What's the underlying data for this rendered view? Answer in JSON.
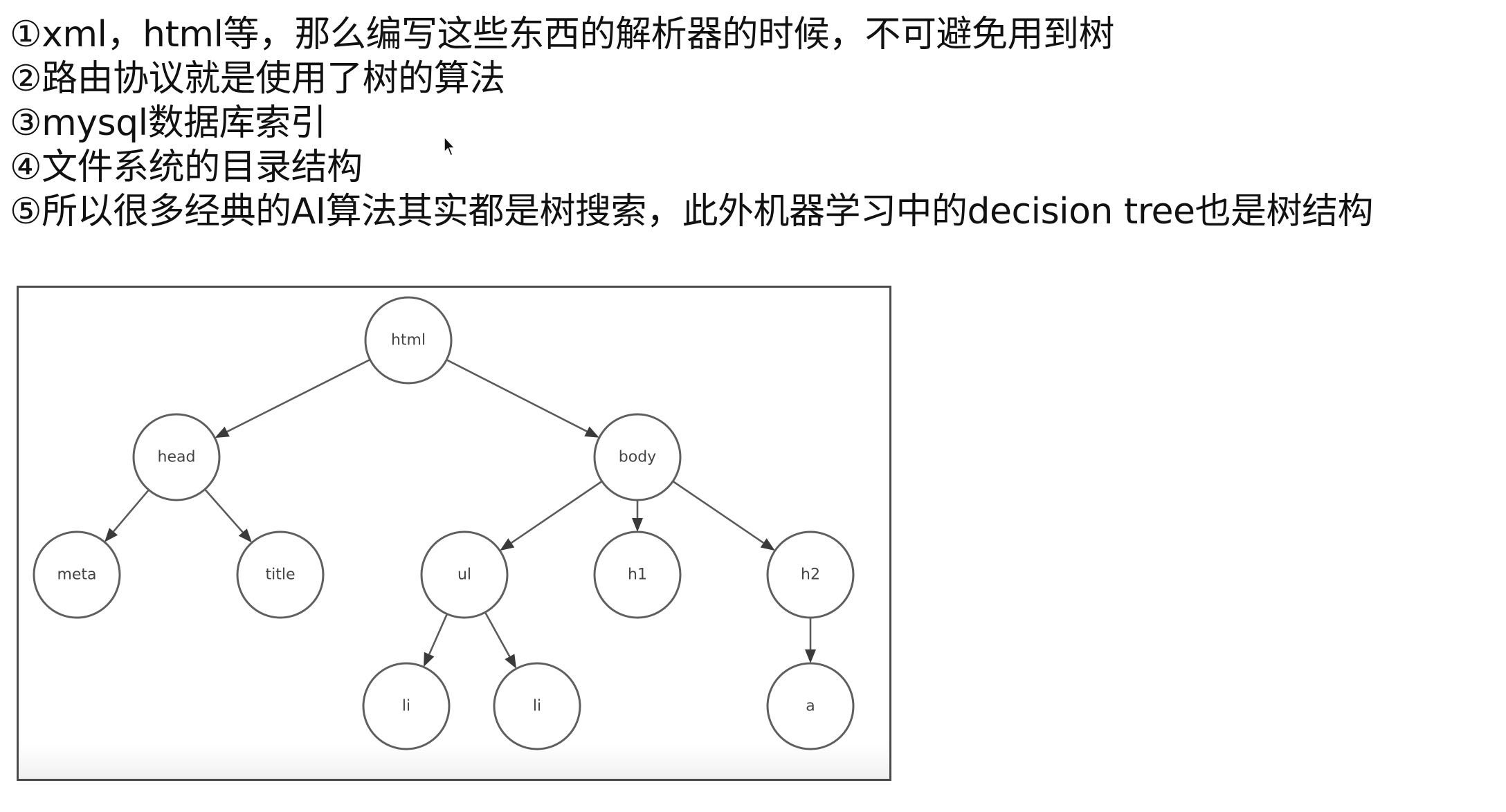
{
  "bullets": [
    "①xml，html等，那么编写这些东西的解析器的时候，不可避免用到树",
    "②路由协议就是使用了树的算法",
    "③mysql数据库索引",
    "④文件系统的目录结构",
    "⑤所以很多经典的AI算法其实都是树搜索，此外机器学习中的decision tree也是树结构"
  ],
  "diagram": {
    "nodes": [
      {
        "id": "html",
        "label": "html"
      },
      {
        "id": "head",
        "label": "head"
      },
      {
        "id": "body",
        "label": "body"
      },
      {
        "id": "meta",
        "label": "meta"
      },
      {
        "id": "title",
        "label": "title"
      },
      {
        "id": "ul",
        "label": "ul"
      },
      {
        "id": "h1",
        "label": "h1"
      },
      {
        "id": "h2",
        "label": "h2"
      },
      {
        "id": "li1",
        "label": "li"
      },
      {
        "id": "li2",
        "label": "li"
      },
      {
        "id": "a",
        "label": "a"
      }
    ],
    "edges": [
      [
        "html",
        "head"
      ],
      [
        "html",
        "body"
      ],
      [
        "head",
        "meta"
      ],
      [
        "head",
        "title"
      ],
      [
        "body",
        "ul"
      ],
      [
        "body",
        "h1"
      ],
      [
        "body",
        "h2"
      ],
      [
        "ul",
        "li1"
      ],
      [
        "ul",
        "li2"
      ],
      [
        "h2",
        "a"
      ]
    ]
  },
  "colors": {
    "text": "#111111",
    "frame": "#4a4a4a",
    "node_stroke": "#5f5f5f",
    "node_label": "#444444"
  },
  "icons": {
    "cursor": "mouse-pointer-icon"
  }
}
